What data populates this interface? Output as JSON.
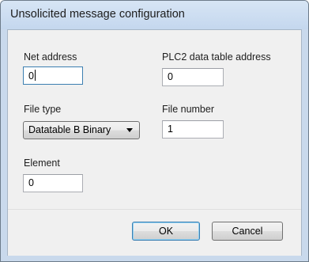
{
  "window": {
    "title": "Unsolicited message configuration"
  },
  "form": {
    "net_address": {
      "label": "Net address",
      "value": "0"
    },
    "plc2_address": {
      "label": "PLC2 data table address",
      "value": "0"
    },
    "file_type": {
      "label": "File type",
      "value": "Datatable B Binary"
    },
    "file_number": {
      "label": "File number",
      "value": "1"
    },
    "element": {
      "label": "Element",
      "value": "0"
    }
  },
  "buttons": {
    "ok_label": "OK",
    "cancel_label": "Cancel"
  }
}
